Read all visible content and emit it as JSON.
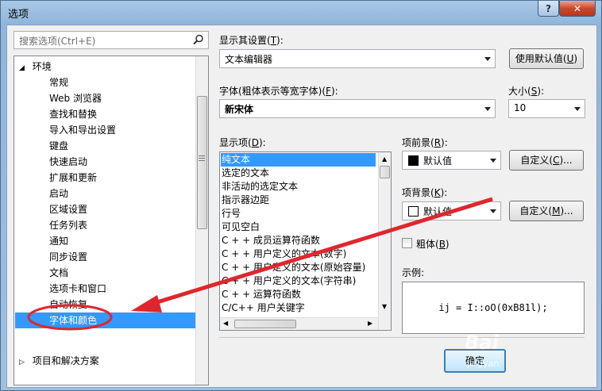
{
  "window": {
    "title": "选项"
  },
  "search": {
    "placeholder": "搜索选项(Ctrl+E)"
  },
  "tree": {
    "root": "环境",
    "items": [
      "常规",
      "Web 浏览器",
      "查找和替换",
      "导入和导出设置",
      "键盘",
      "快速启动",
      "扩展和更新",
      "启动",
      "区域设置",
      "任务列表",
      "通知",
      "同步设置",
      "文档",
      "选项卡和窗口",
      "自动恢复",
      "字体和颜色"
    ],
    "selected": "字体和颜色",
    "next_root": "项目和解决方案"
  },
  "display_settings": {
    "label": "显示其设置(",
    "key": "T",
    "suffix": "):",
    "value": "文本编辑器",
    "use_defaults_label": "使用默认值(",
    "use_defaults_key": "U",
    "use_defaults_suffix": ")"
  },
  "font": {
    "label": "字体(粗体表示等宽字体)(",
    "key": "F",
    "suffix": "):",
    "value": "新宋体",
    "size_label": "大小(",
    "size_key": "S",
    "size_suffix": "):",
    "size_value": "10"
  },
  "display_items": {
    "label": "显示项(",
    "key": "D",
    "suffix": "):",
    "items": [
      "纯文本",
      "选定的文本",
      "非活动的选定文本",
      "指示器边距",
      "行号",
      "可见空白",
      "C + + 成员运算符函数",
      "C + + 用户定义的文本(数字)",
      "C + + 用户定义的文本(原始容量)",
      "C + + 用户定义的文本(字符串)",
      "C + + 运算符函数",
      "C/C++ 用户关键字"
    ],
    "selected": "纯文本"
  },
  "foreground": {
    "label": "项前景(",
    "key": "R",
    "suffix": "):",
    "value": "默认值",
    "color": "#000000",
    "custom_label": "自定义(",
    "custom_key": "C",
    "custom_suffix": ")..."
  },
  "background": {
    "label": "项背景(",
    "key": "K",
    "suffix": "):",
    "value": "默认值",
    "color": "#ffffff",
    "custom_label": "自定义(",
    "custom_key": "M",
    "custom_suffix": ")..."
  },
  "bold": {
    "label": "粗体(",
    "key": "B",
    "suffix": ")"
  },
  "sample": {
    "label": "示例:",
    "text": "ij = I::oO(0xB81l);"
  },
  "ok_button": "确定",
  "colors": {
    "selection": "#3399ff",
    "annotation": "#e0262d"
  }
}
